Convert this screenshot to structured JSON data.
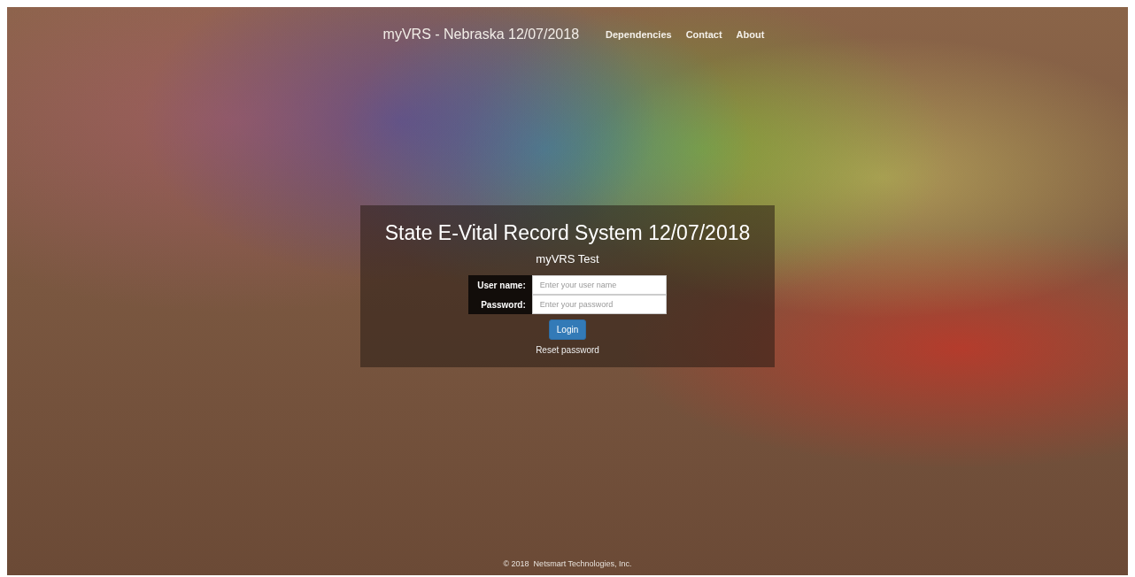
{
  "header": {
    "title": "myVRS - Nebraska 12/07/2018",
    "links": [
      {
        "label": "Dependencies"
      },
      {
        "label": "Contact"
      },
      {
        "label": "About"
      }
    ]
  },
  "login": {
    "title": "State E-Vital Record System 12/07/2018",
    "subtitle": "myVRS Test",
    "fields": [
      {
        "label": "User name:",
        "placeholder": "Enter your user name"
      },
      {
        "label": "Password:",
        "placeholder": "Enter your password"
      }
    ],
    "button": "Login",
    "reset_link": "Reset password"
  },
  "footer": "© 2018  Netsmart Technologies, Inc."
}
